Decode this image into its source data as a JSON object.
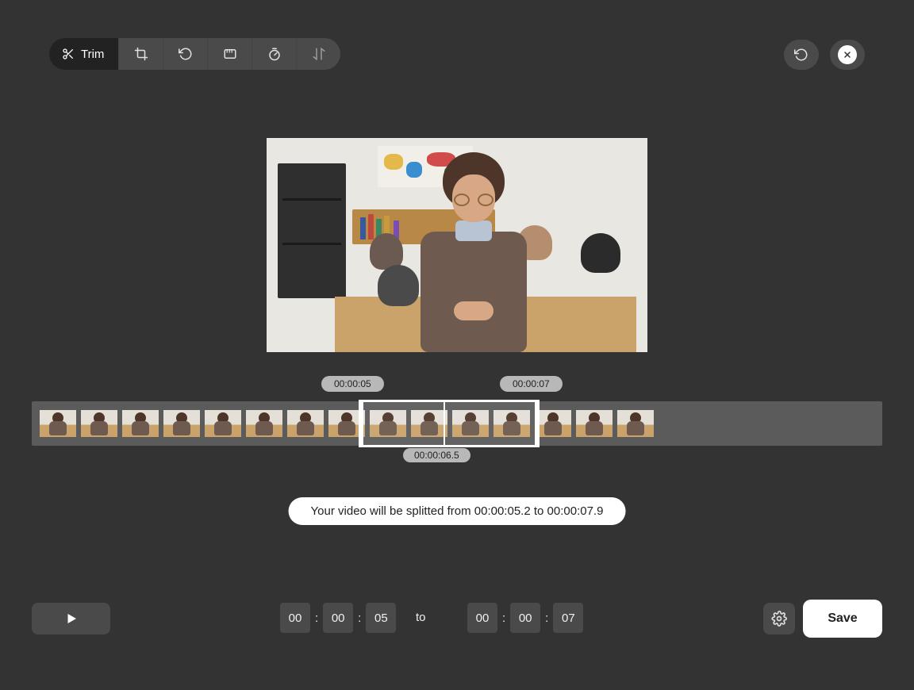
{
  "toolbar": {
    "trim": "Trim"
  },
  "timeline": {
    "start_tag": "00:00:05",
    "end_tag": "00:00:07",
    "playhead_tag": "00:00:06.5"
  },
  "message": {
    "prefix": "Your video will be splitted from ",
    "from": "00:00:05.2",
    "to_word": " to ",
    "to": "00:00:07.9"
  },
  "time_from": {
    "h": "00",
    "m": "00",
    "s": "05"
  },
  "time_to": {
    "h": "00",
    "m": "00",
    "s": "07"
  },
  "labels": {
    "to": "to",
    "save": "Save"
  }
}
